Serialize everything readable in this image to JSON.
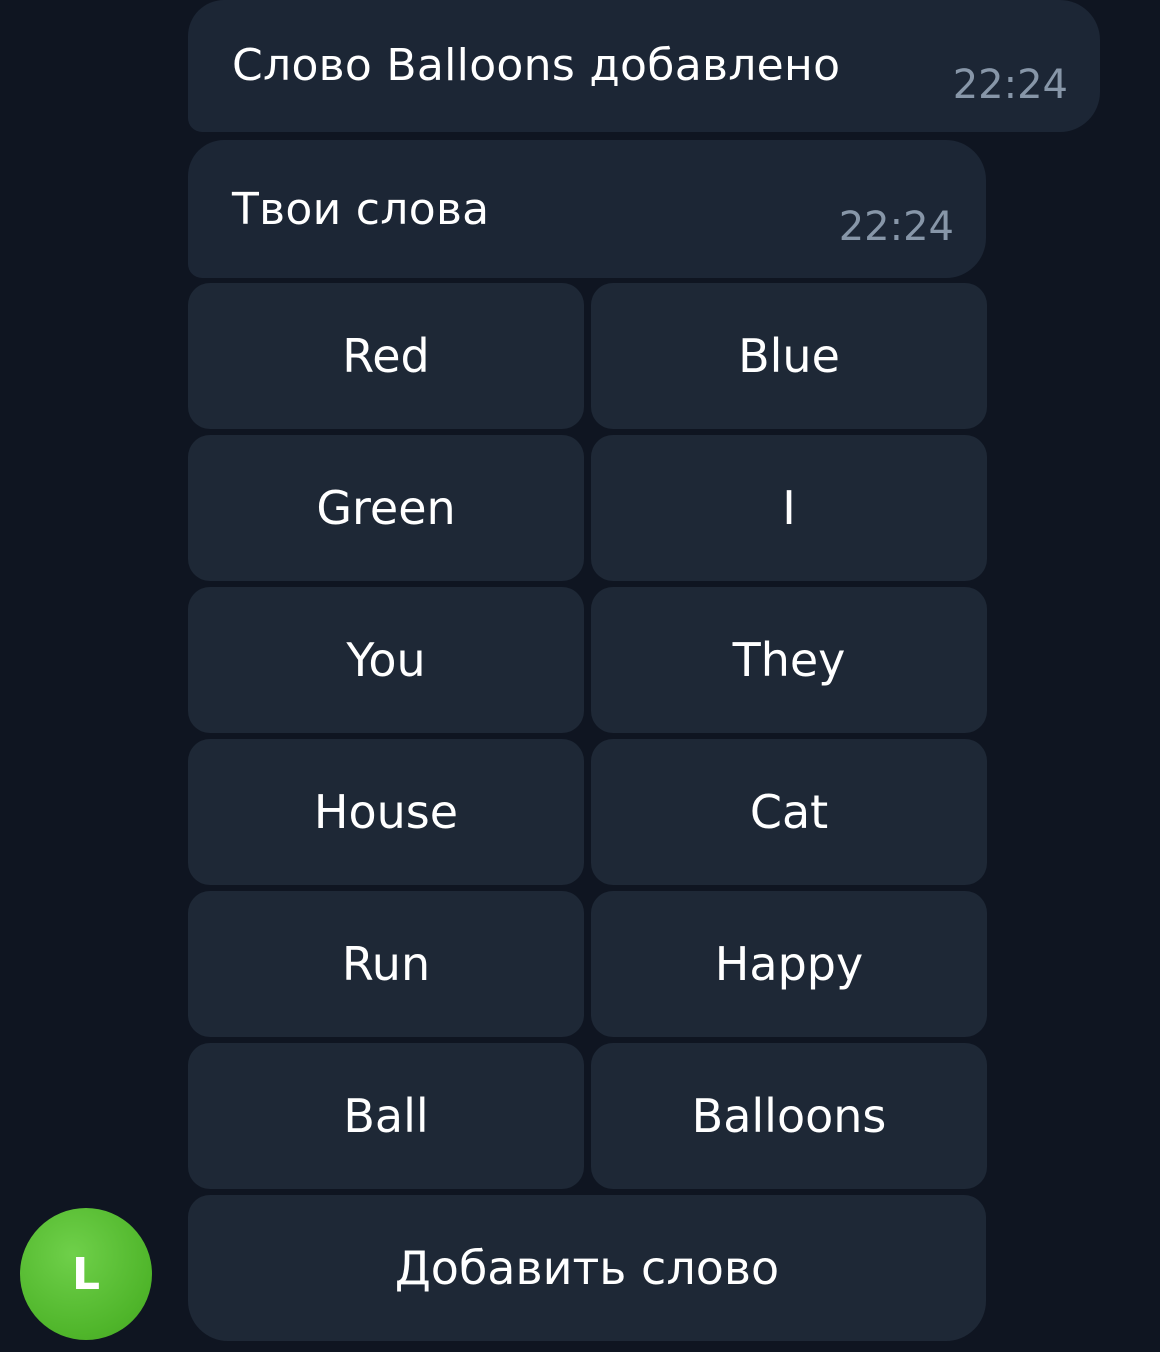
{
  "messages": [
    {
      "text": "Слово Balloons добавлено",
      "time": "22:24"
    },
    {
      "text": "Твои слова",
      "time": "22:24"
    }
  ],
  "keyboard": {
    "rows": [
      [
        "Red",
        "Blue"
      ],
      [
        "Green",
        "I"
      ],
      [
        "You",
        "They"
      ],
      [
        "House",
        "Cat"
      ],
      [
        "Run",
        "Happy"
      ],
      [
        "Ball",
        "Balloons"
      ]
    ],
    "add_word_label": "Добавить слово"
  },
  "avatar": {
    "initial": "L",
    "color": "#56b92e"
  },
  "colors": {
    "background": "#0f1521",
    "bubble": "#1c2635",
    "button": "#1e2836",
    "time": "#8796a8"
  }
}
